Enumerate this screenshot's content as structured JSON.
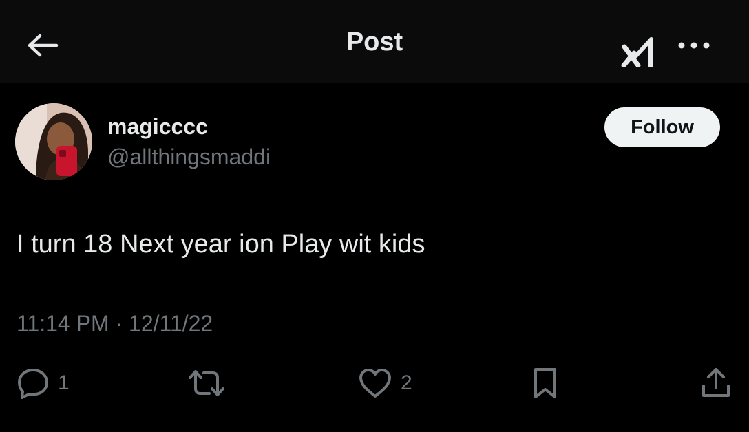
{
  "header": {
    "title": "Post",
    "back_icon": "arrow-left-icon",
    "grok_icon": "grok-icon",
    "more_icon": "more-horizontal-icon"
  },
  "author": {
    "display_name": "magicccc",
    "handle": "@allthingsmaddi",
    "follow_label": "Follow"
  },
  "post": {
    "text": "I turn 18 Next year ion Play wit kids",
    "timestamp": "11:14 PM · 12/11/22"
  },
  "actions": {
    "replies": {
      "icon": "reply-icon",
      "count": "1"
    },
    "reposts": {
      "icon": "repost-icon"
    },
    "likes": {
      "icon": "like-icon",
      "count": "2"
    },
    "bookmark": {
      "icon": "bookmark-icon"
    },
    "share": {
      "icon": "share-icon"
    }
  },
  "colors": {
    "background": "#000000",
    "header_background": "#0b0b0b",
    "primary_text": "#e7e9ea",
    "secondary_text": "#71767b",
    "follow_button": "#eff3f4"
  }
}
